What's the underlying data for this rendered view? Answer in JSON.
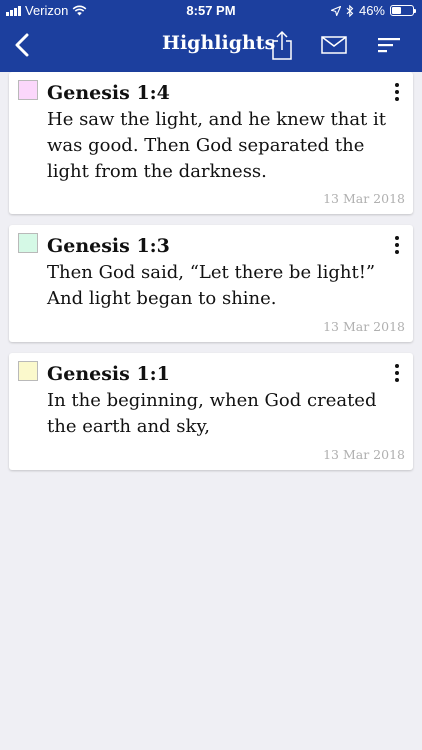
{
  "status_bar": {
    "carrier": "Verizon",
    "time": "8:57 PM",
    "battery": "46%",
    "battery_level": 0.46,
    "icons": [
      "signal-icon",
      "wifi-icon",
      "location-arrow-icon",
      "bluetooth-icon",
      "battery-icon"
    ]
  },
  "navbar": {
    "title": "Highlights",
    "back_icon": "chevron-left-icon",
    "share_icon": "share-icon",
    "mail_icon": "mail-icon",
    "sort_icon": "sort-icon"
  },
  "colors": {
    "header": "#1c3f9e",
    "background": "#efeff4"
  },
  "highlights": [
    {
      "reference": "Genesis 1:4",
      "text": "He saw the light, and he knew that it was good. Then God separated the light from the darkness.",
      "date": "13 Mar 2018",
      "color": "#fbd7fb"
    },
    {
      "reference": "Genesis 1:3",
      "text": "Then God said, “Let there be light!” And light began to shine.",
      "date": "13 Mar 2018",
      "color": "#d5f9e6"
    },
    {
      "reference": "Genesis 1:1",
      "text": "In the beginning, when God created the earth and sky,",
      "date": "13 Mar 2018",
      "color": "#fbf9cc"
    }
  ]
}
